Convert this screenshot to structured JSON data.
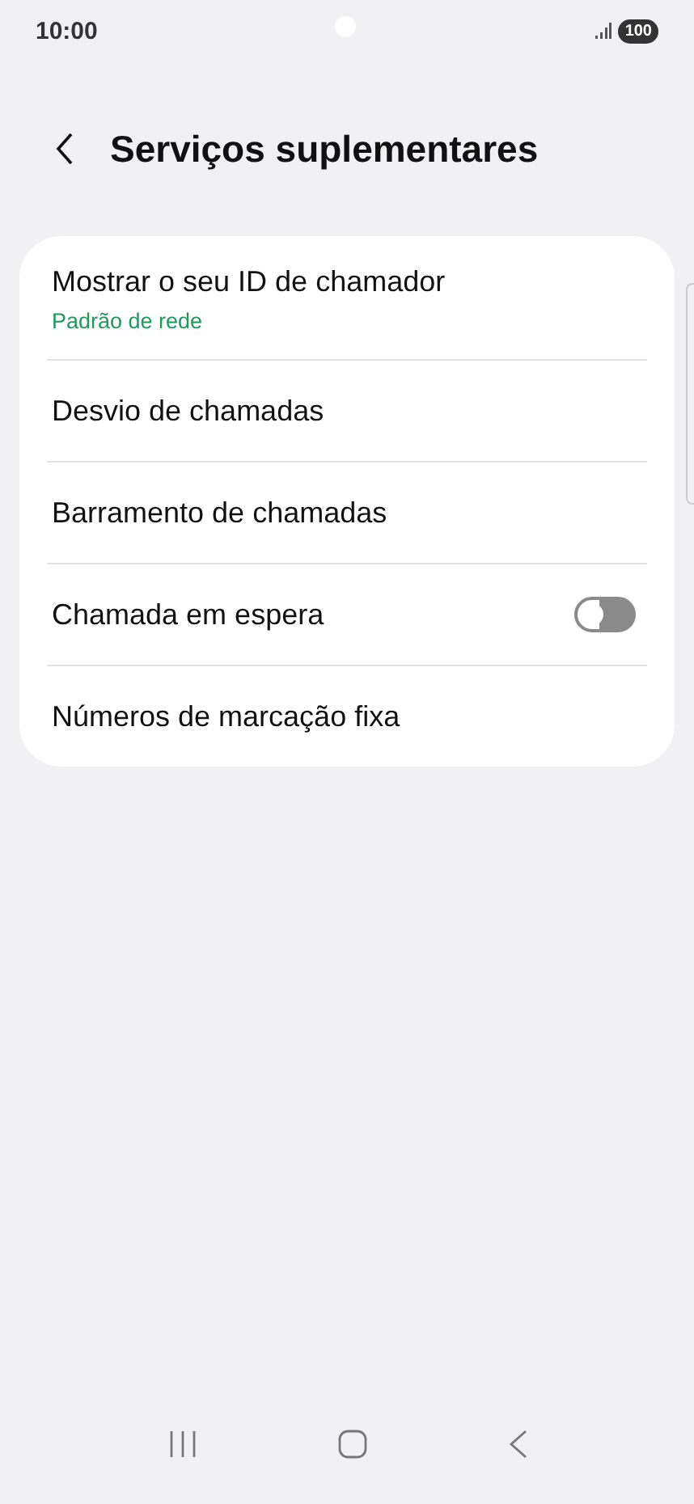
{
  "status_bar": {
    "time": "10:00",
    "battery": "100"
  },
  "header": {
    "title": "Serviços suplementares"
  },
  "items": [
    {
      "kind": "text",
      "label": "Mostrar o seu ID de chamador",
      "summary": "Padrão de rede"
    },
    {
      "kind": "text",
      "label": "Desvio de chamadas"
    },
    {
      "kind": "text",
      "label": "Barramento de chamadas"
    },
    {
      "kind": "switch",
      "label": "Chamada em espera",
      "on": false
    },
    {
      "kind": "text",
      "label": "Números de marcação fixa"
    }
  ]
}
